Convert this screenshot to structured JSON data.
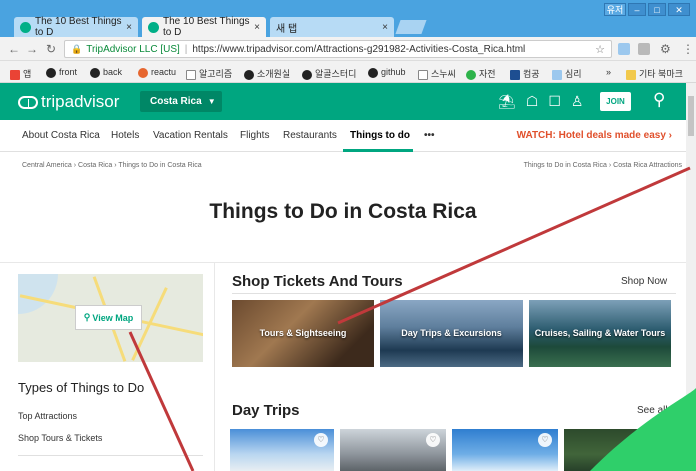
{
  "browser": {
    "tabs": [
      {
        "title": "The 10 Best Things to D",
        "close": "×"
      },
      {
        "title": "The 10 Best Things to D",
        "close": "×"
      },
      {
        "title": "새 탭",
        "close": "×"
      }
    ],
    "window_user": "유저",
    "url_secure": "TripAdvisor LLC [US]",
    "url": "https://www.tripadvisor.com/Attractions-g291982-Activities-Costa_Rica.html",
    "bookmarks": [
      "앱",
      "front",
      "back",
      "reactu",
      "알고리즘",
      "소개원실",
      "알골스터디",
      "github",
      "스누씨",
      "자전",
      "컴공",
      "심리",
      "»",
      "기타 북마크"
    ]
  },
  "header": {
    "logo": "tripadvisor",
    "location": "Costa Rica",
    "join": "JOIN"
  },
  "nav": {
    "items": [
      "About Costa Rica",
      "Hotels",
      "Vacation Rentals",
      "Flights",
      "Restaurants",
      "Things to do",
      "•••"
    ],
    "promo": "WATCH: Hotel deals made easy ›"
  },
  "breadcrumb": {
    "left": "Central America › Costa Rica › Things to Do in Costa Rica",
    "right": "Things to Do in Costa Rica › Costa Rica Attractions"
  },
  "page_title": "Things to Do in Costa Rica",
  "sidebar": {
    "view_map": "View Map",
    "types_title": "Types of Things to Do",
    "links": [
      "Top Attractions",
      "Shop Tours & Tickets"
    ]
  },
  "shop": {
    "title": "Shop Tickets And Tours",
    "shop_now": "Shop Now",
    "tiles": [
      "Tours & Sightseeing",
      "Day Trips & Excursions",
      "Cruises, Sailing & Water Tours"
    ]
  },
  "day_trips": {
    "title": "Day Trips",
    "see_all": "See all"
  },
  "colors": {
    "brand": "#00a680",
    "promo": "#e0502c",
    "annotation": "#c0393b",
    "chrome_blue": "#4aa3e0"
  }
}
